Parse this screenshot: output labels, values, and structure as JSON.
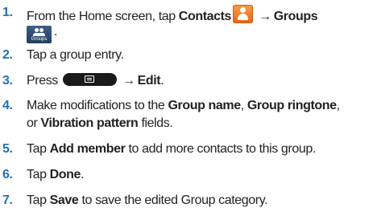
{
  "steps": [
    {
      "number": "1.",
      "text_1": "From the Home screen, tap ",
      "bold_1": "Contacts",
      "arrow_1": "→",
      "bold_2": "Groups",
      "end": ".",
      "icon_contacts": "contacts-icon",
      "icon_groups": "groups-icon",
      "groups_icon_label": "Groups"
    },
    {
      "number": "2.",
      "text_1": "Tap a group entry."
    },
    {
      "number": "3.",
      "text_1": "Press ",
      "icon_menu": "menu-key-icon",
      "arrow_1": "→",
      "bold_1": "Edit",
      "end": "."
    },
    {
      "number": "4.",
      "text_1": "Make modifications to the ",
      "bold_1": "Group name",
      "text_2": ", ",
      "bold_2": "Group ringtone",
      "text_3": ",",
      "text_4": "or ",
      "bold_3": "Vibration pattern",
      "text_5": " fields."
    },
    {
      "number": "5.",
      "text_1": "Tap ",
      "bold_1": "Add member",
      "text_2": " to add more contacts to this group."
    },
    {
      "number": "6.",
      "text_1": "Tap ",
      "bold_1": "Done",
      "end": "."
    },
    {
      "number": "7.",
      "text_1": "Tap ",
      "bold_1": "Save",
      "text_2": " to save the edited Group category."
    }
  ],
  "colors": {
    "step_number": "#1d72b8",
    "text": "#222222",
    "contacts_icon": "#ee7a2a",
    "groups_icon": "#2f4b6e",
    "menu_key": "#1a1a1a"
  }
}
